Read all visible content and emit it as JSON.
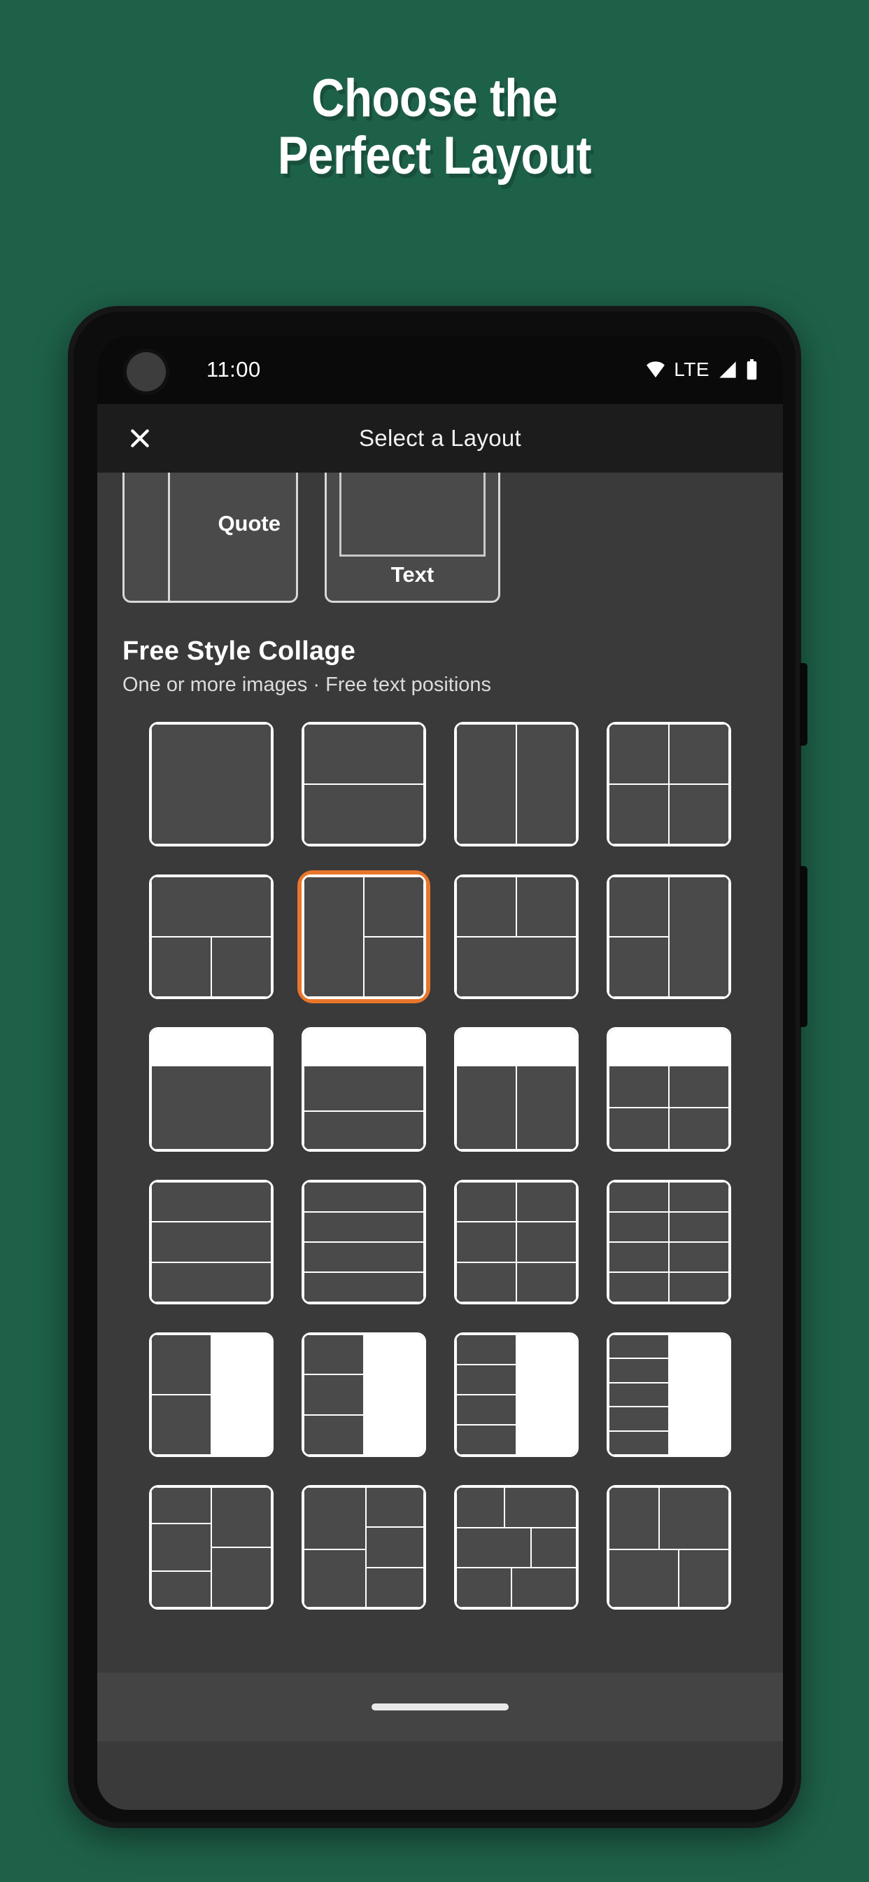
{
  "promo": {
    "line1": "Choose the",
    "line2": "Perfect Layout",
    "bg_color": "#1E6149",
    "text_color": "#FFFFFF"
  },
  "phone": {
    "statusbar": {
      "time": "11:00",
      "wifi_icon": "wifi-icon",
      "network_label": "LTE",
      "signal_icon": "signal-bars-icon",
      "battery_icon": "battery-full-icon"
    },
    "appbar": {
      "close_icon": "close-icon",
      "title": "Select a Layout"
    },
    "navbar": {
      "gesture_pill": "home-gesture-pill"
    }
  },
  "peek_row": [
    {
      "label": "Quote",
      "kind": "quote-split"
    },
    {
      "label": "Text",
      "kind": "image-over-text"
    }
  ],
  "section": {
    "title": "Free Style Collage",
    "subtitle": "One or more images · Free text positions"
  },
  "selection": {
    "selected_index": 5,
    "accent_color": "#E8762B"
  },
  "layouts": [
    {
      "id": "single",
      "name": "single-cell",
      "segments": [
        [
          0,
          0,
          100,
          100,
          0
        ]
      ]
    },
    {
      "id": "rows-2",
      "name": "two-rows",
      "segments": [
        [
          0,
          0,
          100,
          50,
          0
        ],
        [
          0,
          50,
          100,
          50,
          0
        ]
      ]
    },
    {
      "id": "cols-2",
      "name": "two-columns",
      "segments": [
        [
          0,
          0,
          50,
          100,
          0
        ],
        [
          50,
          0,
          50,
          100,
          0
        ]
      ]
    },
    {
      "id": "grid-2x2",
      "name": "grid-2x2",
      "segments": [
        [
          0,
          0,
          50,
          50,
          0
        ],
        [
          50,
          0,
          50,
          50,
          0
        ],
        [
          0,
          50,
          50,
          50,
          0
        ],
        [
          50,
          50,
          50,
          50,
          0
        ]
      ]
    },
    {
      "id": "top-full-bottom-2",
      "name": "top-full-bottom-split",
      "segments": [
        [
          0,
          0,
          100,
          50,
          0
        ],
        [
          0,
          50,
          50,
          50,
          0
        ],
        [
          50,
          50,
          50,
          50,
          0
        ]
      ]
    },
    {
      "id": "left-full-right-2",
      "name": "left-full-right-split",
      "segments": [
        [
          0,
          0,
          50,
          100,
          0
        ],
        [
          50,
          0,
          50,
          50,
          0
        ],
        [
          50,
          50,
          50,
          50,
          0
        ]
      ]
    },
    {
      "id": "top-2-bottom-full",
      "name": "top-split-bottom-full",
      "segments": [
        [
          0,
          0,
          50,
          50,
          0
        ],
        [
          50,
          0,
          50,
          50,
          0
        ],
        [
          0,
          50,
          100,
          50,
          0
        ]
      ]
    },
    {
      "id": "left-2-right-full",
      "name": "left-split-right-full",
      "segments": [
        [
          0,
          0,
          50,
          50,
          0
        ],
        [
          0,
          50,
          50,
          50,
          0
        ],
        [
          50,
          0,
          50,
          100,
          0
        ]
      ]
    },
    {
      "id": "wtop-1",
      "name": "white-band-single",
      "segments": [
        [
          0,
          0,
          100,
          30,
          1
        ],
        [
          0,
          30,
          100,
          70,
          0
        ]
      ]
    },
    {
      "id": "wtop-rows2",
      "name": "white-band-two-rows",
      "segments": [
        [
          0,
          0,
          100,
          30,
          1
        ],
        [
          0,
          30,
          100,
          38,
          0
        ],
        [
          0,
          68,
          100,
          32,
          0
        ]
      ]
    },
    {
      "id": "wtop-cols2",
      "name": "white-band-two-columns",
      "segments": [
        [
          0,
          0,
          100,
          30,
          1
        ],
        [
          0,
          30,
          50,
          70,
          0
        ],
        [
          50,
          30,
          50,
          70,
          0
        ]
      ]
    },
    {
      "id": "wtop-grid2x2",
      "name": "white-band-grid-2x2",
      "segments": [
        [
          0,
          0,
          100,
          30,
          1
        ],
        [
          0,
          30,
          50,
          35,
          0
        ],
        [
          50,
          30,
          50,
          35,
          0
        ],
        [
          0,
          65,
          50,
          35,
          0
        ],
        [
          50,
          65,
          50,
          35,
          0
        ]
      ]
    },
    {
      "id": "rows-3",
      "name": "three-rows",
      "segments": [
        [
          0,
          0,
          100,
          33.3,
          0
        ],
        [
          0,
          33.3,
          100,
          33.4,
          0
        ],
        [
          0,
          66.7,
          100,
          33.3,
          0
        ]
      ]
    },
    {
      "id": "rows-4",
      "name": "four-rows",
      "segments": [
        [
          0,
          0,
          100,
          25,
          0
        ],
        [
          0,
          25,
          100,
          25,
          0
        ],
        [
          0,
          50,
          100,
          25,
          0
        ],
        [
          0,
          75,
          100,
          25,
          0
        ]
      ]
    },
    {
      "id": "grid-2x3",
      "name": "grid-2x3",
      "segments": [
        [
          0,
          0,
          50,
          33.3,
          0
        ],
        [
          50,
          0,
          50,
          33.3,
          0
        ],
        [
          0,
          33.3,
          50,
          33.4,
          0
        ],
        [
          50,
          33.3,
          50,
          33.4,
          0
        ],
        [
          0,
          66.7,
          50,
          33.3,
          0
        ],
        [
          50,
          66.7,
          50,
          33.3,
          0
        ]
      ]
    },
    {
      "id": "grid-2x4",
      "name": "grid-2x4",
      "segments": [
        [
          0,
          0,
          50,
          25,
          0
        ],
        [
          50,
          0,
          50,
          25,
          0
        ],
        [
          0,
          25,
          50,
          25,
          0
        ],
        [
          50,
          25,
          50,
          25,
          0
        ],
        [
          0,
          50,
          50,
          25,
          0
        ],
        [
          50,
          50,
          50,
          25,
          0
        ],
        [
          0,
          75,
          50,
          25,
          0
        ],
        [
          50,
          75,
          50,
          25,
          0
        ]
      ]
    },
    {
      "id": "side-2",
      "name": "dark-left-white-right-2",
      "segments": [
        [
          0,
          0,
          50,
          50,
          0
        ],
        [
          0,
          50,
          50,
          50,
          0
        ],
        [
          50,
          0,
          50,
          50,
          1
        ],
        [
          50,
          50,
          50,
          50,
          1
        ]
      ]
    },
    {
      "id": "side-3",
      "name": "dark-left-white-right-3",
      "segments": [
        [
          0,
          0,
          50,
          33.3,
          0
        ],
        [
          0,
          33.3,
          50,
          33.4,
          0
        ],
        [
          0,
          66.7,
          50,
          33.3,
          0
        ],
        [
          50,
          0,
          50,
          33.3,
          1
        ],
        [
          50,
          33.3,
          50,
          33.4,
          1
        ],
        [
          50,
          66.7,
          50,
          33.3,
          1
        ]
      ]
    },
    {
      "id": "side-4",
      "name": "dark-left-white-right-4",
      "segments": [
        [
          0,
          0,
          50,
          25,
          0
        ],
        [
          0,
          25,
          50,
          25,
          0
        ],
        [
          0,
          50,
          50,
          25,
          0
        ],
        [
          0,
          75,
          50,
          25,
          0
        ],
        [
          50,
          0,
          50,
          25,
          1
        ],
        [
          50,
          25,
          50,
          25,
          1
        ],
        [
          50,
          50,
          50,
          25,
          1
        ],
        [
          50,
          75,
          50,
          25,
          1
        ]
      ]
    },
    {
      "id": "side-5",
      "name": "dark-left-white-right-5",
      "segments": [
        [
          0,
          0,
          50,
          20,
          0
        ],
        [
          0,
          20,
          50,
          20,
          0
        ],
        [
          0,
          40,
          50,
          20,
          0
        ],
        [
          0,
          60,
          50,
          20,
          0
        ],
        [
          0,
          80,
          50,
          20,
          0
        ],
        [
          50,
          0,
          50,
          20,
          1
        ],
        [
          50,
          20,
          50,
          20,
          1
        ],
        [
          50,
          40,
          50,
          20,
          1
        ],
        [
          50,
          60,
          50,
          20,
          1
        ],
        [
          50,
          80,
          50,
          20,
          1
        ]
      ]
    },
    {
      "id": "mosaic-a",
      "name": "mosaic-left-three-right-two",
      "segments": [
        [
          0,
          0,
          50,
          30,
          0
        ],
        [
          0,
          30,
          50,
          40,
          0
        ],
        [
          0,
          70,
          50,
          30,
          0
        ],
        [
          50,
          0,
          50,
          50,
          0
        ],
        [
          50,
          50,
          50,
          50,
          0
        ]
      ]
    },
    {
      "id": "mosaic-b",
      "name": "mosaic-left-two-right-three",
      "segments": [
        [
          0,
          0,
          52,
          52,
          0
        ],
        [
          0,
          52,
          52,
          48,
          0
        ],
        [
          52,
          0,
          48,
          33,
          0
        ],
        [
          52,
          33,
          48,
          34,
          0
        ],
        [
          52,
          67,
          48,
          33,
          0
        ]
      ]
    },
    {
      "id": "mosaic-c",
      "name": "mosaic-staggered",
      "segments": [
        [
          0,
          0,
          40,
          34,
          0
        ],
        [
          40,
          0,
          60,
          34,
          0
        ],
        [
          0,
          34,
          62,
          33,
          0
        ],
        [
          62,
          34,
          38,
          33,
          0
        ],
        [
          0,
          67,
          46,
          33,
          0
        ],
        [
          46,
          67,
          54,
          33,
          0
        ]
      ]
    },
    {
      "id": "mosaic-d",
      "name": "mosaic-tall-left-wide-right",
      "segments": [
        [
          0,
          0,
          42,
          52,
          0
        ],
        [
          42,
          0,
          58,
          52,
          0
        ],
        [
          0,
          52,
          58,
          48,
          0
        ],
        [
          58,
          52,
          42,
          48,
          0
        ]
      ]
    }
  ]
}
